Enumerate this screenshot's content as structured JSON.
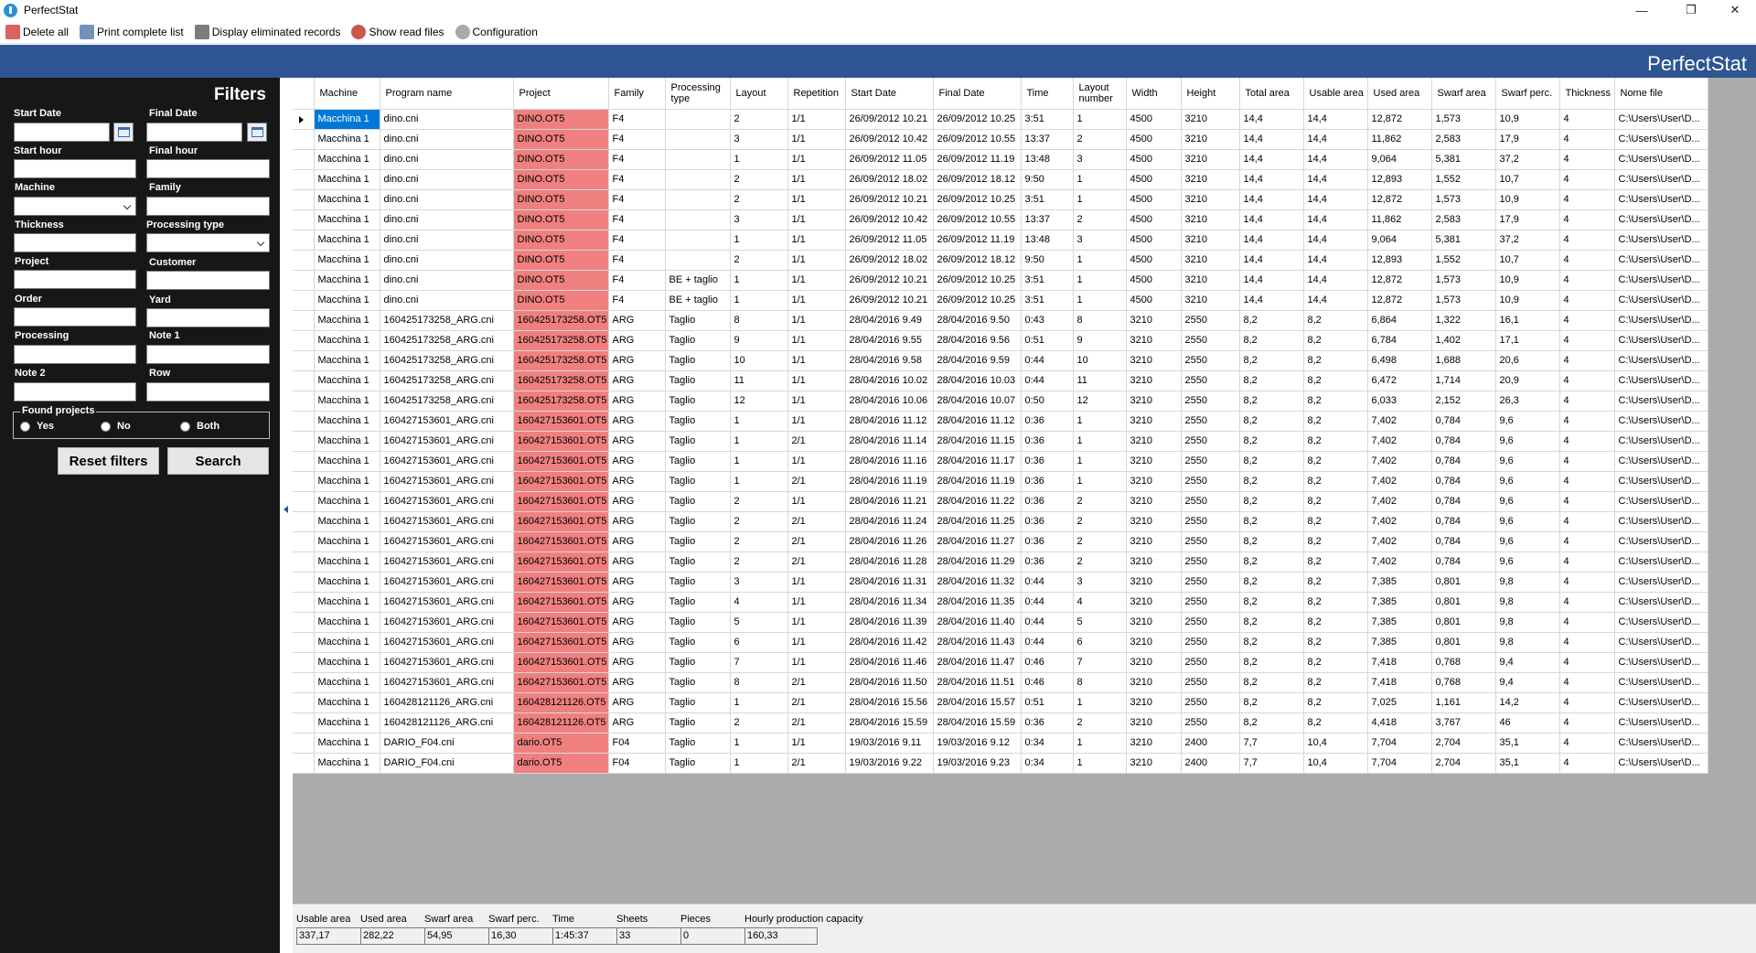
{
  "window": {
    "title": "PerfectStat",
    "minimize": "—",
    "maximize": "❐",
    "close": "✕"
  },
  "toolbar": [
    {
      "label": "Delete all",
      "icon": "eraser-icon",
      "color": "#d64545"
    },
    {
      "label": "Print complete list",
      "icon": "printer-icon",
      "color": "#5b7fae"
    },
    {
      "label": "Display eliminated records",
      "icon": "trash-icon",
      "color": "#666666"
    },
    {
      "label": "Show read files",
      "icon": "file-list-icon",
      "color": "#c0392b"
    },
    {
      "label": "Configuration",
      "icon": "gear-icon",
      "color": "#999999"
    }
  ],
  "banner": {
    "title": "PerfectStat"
  },
  "filters": {
    "title": "Filters",
    "start_date": "Start Date",
    "final_date": "Final Date",
    "start_hour": "Start hour",
    "final_hour": "Final hour",
    "machine": "Machine",
    "family": "Family",
    "thickness": "Thickness",
    "processing_type": "Processing type",
    "project": "Project",
    "customer": "Customer",
    "order": "Order",
    "yard": "Yard",
    "processing": "Processing",
    "note1": "Note 1",
    "note2": "Note 2",
    "row": "Row",
    "found_projects": "Found projects",
    "yes": "Yes",
    "no": "No",
    "both": "Both",
    "reset": "Reset filters",
    "search": "Search"
  },
  "columns": [
    "Machine",
    "Program name",
    "Project",
    "Family",
    "Processing type",
    "Layout",
    "Repetition",
    "Start Date",
    "Final Date",
    "Time",
    "Layout number",
    "Width",
    "Height",
    "Total area",
    "Usable area",
    "Used area",
    "Swarf area",
    "Swarf perc.",
    "Thickness",
    "Nome file"
  ],
  "rows": [
    [
      "Macchina 1",
      "dino.cni",
      "DINO.OT5",
      "F4",
      "",
      "2",
      "1/1",
      "26/09/2012 10.21",
      "26/09/2012 10.25",
      "3:51",
      "1",
      "4500",
      "3210",
      "14,4",
      "14,4",
      "12,872",
      "1,573",
      "10,9",
      "4",
      "C:\\Users\\User\\D..."
    ],
    [
      "Macchina 1",
      "dino.cni",
      "DINO.OT5",
      "F4",
      "",
      "3",
      "1/1",
      "26/09/2012 10.42",
      "26/09/2012 10.55",
      "13:37",
      "2",
      "4500",
      "3210",
      "14,4",
      "14,4",
      "11,862",
      "2,583",
      "17,9",
      "4",
      "C:\\Users\\User\\D..."
    ],
    [
      "Macchina 1",
      "dino.cni",
      "DINO.OT5",
      "F4",
      "",
      "1",
      "1/1",
      "26/09/2012 11.05",
      "26/09/2012 11.19",
      "13:48",
      "3",
      "4500",
      "3210",
      "14,4",
      "14,4",
      "9,064",
      "5,381",
      "37,2",
      "4",
      "C:\\Users\\User\\D..."
    ],
    [
      "Macchina 1",
      "dino.cni",
      "DINO.OT5",
      "F4",
      "",
      "2",
      "1/1",
      "26/09/2012 18.02",
      "26/09/2012 18.12",
      "9:50",
      "1",
      "4500",
      "3210",
      "14,4",
      "14,4",
      "12,893",
      "1,552",
      "10,7",
      "4",
      "C:\\Users\\User\\D..."
    ],
    [
      "Macchina 1",
      "dino.cni",
      "DINO.OT5",
      "F4",
      "",
      "2",
      "1/1",
      "26/09/2012 10.21",
      "26/09/2012 10.25",
      "3:51",
      "1",
      "4500",
      "3210",
      "14,4",
      "14,4",
      "12,872",
      "1,573",
      "10,9",
      "4",
      "C:\\Users\\User\\D..."
    ],
    [
      "Macchina 1",
      "dino.cni",
      "DINO.OT5",
      "F4",
      "",
      "3",
      "1/1",
      "26/09/2012 10.42",
      "26/09/2012 10.55",
      "13:37",
      "2",
      "4500",
      "3210",
      "14,4",
      "14,4",
      "11,862",
      "2,583",
      "17,9",
      "4",
      "C:\\Users\\User\\D..."
    ],
    [
      "Macchina 1",
      "dino.cni",
      "DINO.OT5",
      "F4",
      "",
      "1",
      "1/1",
      "26/09/2012 11.05",
      "26/09/2012 11.19",
      "13:48",
      "3",
      "4500",
      "3210",
      "14,4",
      "14,4",
      "9,064",
      "5,381",
      "37,2",
      "4",
      "C:\\Users\\User\\D..."
    ],
    [
      "Macchina 1",
      "dino.cni",
      "DINO.OT5",
      "F4",
      "",
      "2",
      "1/1",
      "26/09/2012 18.02",
      "26/09/2012 18.12",
      "9:50",
      "1",
      "4500",
      "3210",
      "14,4",
      "14,4",
      "12,893",
      "1,552",
      "10,7",
      "4",
      "C:\\Users\\User\\D..."
    ],
    [
      "Macchina 1",
      "dino.cni",
      "DINO.OT5",
      "F4",
      "BE + taglio",
      "1",
      "1/1",
      "26/09/2012 10.21",
      "26/09/2012 10.25",
      "3:51",
      "1",
      "4500",
      "3210",
      "14,4",
      "14,4",
      "12,872",
      "1,573",
      "10,9",
      "4",
      "C:\\Users\\User\\D..."
    ],
    [
      "Macchina 1",
      "dino.cni",
      "DINO.OT5",
      "F4",
      "BE + taglio",
      "1",
      "1/1",
      "26/09/2012 10.21",
      "26/09/2012 10.25",
      "3:51",
      "1",
      "4500",
      "3210",
      "14,4",
      "14,4",
      "12,872",
      "1,573",
      "10,9",
      "4",
      "C:\\Users\\User\\D..."
    ],
    [
      "Macchina 1",
      "160425173258_ARG.cni",
      "160425173258.OT5",
      "ARG",
      "Taglio",
      "8",
      "1/1",
      "28/04/2016 9.49",
      "28/04/2016 9.50",
      "0:43",
      "8",
      "3210",
      "2550",
      "8,2",
      "8,2",
      "6,864",
      "1,322",
      "16,1",
      "4",
      "C:\\Users\\User\\D..."
    ],
    [
      "Macchina 1",
      "160425173258_ARG.cni",
      "160425173258.OT5",
      "ARG",
      "Taglio",
      "9",
      "1/1",
      "28/04/2016 9.55",
      "28/04/2016 9.56",
      "0:51",
      "9",
      "3210",
      "2550",
      "8,2",
      "8,2",
      "6,784",
      "1,402",
      "17,1",
      "4",
      "C:\\Users\\User\\D..."
    ],
    [
      "Macchina 1",
      "160425173258_ARG.cni",
      "160425173258.OT5",
      "ARG",
      "Taglio",
      "10",
      "1/1",
      "28/04/2016 9.58",
      "28/04/2016 9.59",
      "0:44",
      "10",
      "3210",
      "2550",
      "8,2",
      "8,2",
      "6,498",
      "1,688",
      "20,6",
      "4",
      "C:\\Users\\User\\D..."
    ],
    [
      "Macchina 1",
      "160425173258_ARG.cni",
      "160425173258.OT5",
      "ARG",
      "Taglio",
      "11",
      "1/1",
      "28/04/2016 10.02",
      "28/04/2016 10.03",
      "0:44",
      "11",
      "3210",
      "2550",
      "8,2",
      "8,2",
      "6,472",
      "1,714",
      "20,9",
      "4",
      "C:\\Users\\User\\D..."
    ],
    [
      "Macchina 1",
      "160425173258_ARG.cni",
      "160425173258.OT5",
      "ARG",
      "Taglio",
      "12",
      "1/1",
      "28/04/2016 10.06",
      "28/04/2016 10.07",
      "0:50",
      "12",
      "3210",
      "2550",
      "8,2",
      "8,2",
      "6,033",
      "2,152",
      "26,3",
      "4",
      "C:\\Users\\User\\D..."
    ],
    [
      "Macchina 1",
      "160427153601_ARG.cni",
      "160427153601.OT5",
      "ARG",
      "Taglio",
      "1",
      "1/1",
      "28/04/2016 11.12",
      "28/04/2016 11.12",
      "0:36",
      "1",
      "3210",
      "2550",
      "8,2",
      "8,2",
      "7,402",
      "0,784",
      "9,6",
      "4",
      "C:\\Users\\User\\D..."
    ],
    [
      "Macchina 1",
      "160427153601_ARG.cni",
      "160427153601.OT5",
      "ARG",
      "Taglio",
      "1",
      "2/1",
      "28/04/2016 11.14",
      "28/04/2016 11.15",
      "0:36",
      "1",
      "3210",
      "2550",
      "8,2",
      "8,2",
      "7,402",
      "0,784",
      "9,6",
      "4",
      "C:\\Users\\User\\D..."
    ],
    [
      "Macchina 1",
      "160427153601_ARG.cni",
      "160427153601.OT5",
      "ARG",
      "Taglio",
      "1",
      "1/1",
      "28/04/2016 11.16",
      "28/04/2016 11.17",
      "0:36",
      "1",
      "3210",
      "2550",
      "8,2",
      "8,2",
      "7,402",
      "0,784",
      "9,6",
      "4",
      "C:\\Users\\User\\D..."
    ],
    [
      "Macchina 1",
      "160427153601_ARG.cni",
      "160427153601.OT5",
      "ARG",
      "Taglio",
      "1",
      "2/1",
      "28/04/2016 11.19",
      "28/04/2016 11.19",
      "0:36",
      "1",
      "3210",
      "2550",
      "8,2",
      "8,2",
      "7,402",
      "0,784",
      "9,6",
      "4",
      "C:\\Users\\User\\D..."
    ],
    [
      "Macchina 1",
      "160427153601_ARG.cni",
      "160427153601.OT5",
      "ARG",
      "Taglio",
      "2",
      "1/1",
      "28/04/2016 11.21",
      "28/04/2016 11.22",
      "0:36",
      "2",
      "3210",
      "2550",
      "8,2",
      "8,2",
      "7,402",
      "0,784",
      "9,6",
      "4",
      "C:\\Users\\User\\D..."
    ],
    [
      "Macchina 1",
      "160427153601_ARG.cni",
      "160427153601.OT5",
      "ARG",
      "Taglio",
      "2",
      "2/1",
      "28/04/2016 11.24",
      "28/04/2016 11.25",
      "0:36",
      "2",
      "3210",
      "2550",
      "8,2",
      "8,2",
      "7,402",
      "0,784",
      "9,6",
      "4",
      "C:\\Users\\User\\D..."
    ],
    [
      "Macchina 1",
      "160427153601_ARG.cni",
      "160427153601.OT5",
      "ARG",
      "Taglio",
      "2",
      "2/1",
      "28/04/2016 11.26",
      "28/04/2016 11.27",
      "0:36",
      "2",
      "3210",
      "2550",
      "8,2",
      "8,2",
      "7,402",
      "0,784",
      "9,6",
      "4",
      "C:\\Users\\User\\D..."
    ],
    [
      "Macchina 1",
      "160427153601_ARG.cni",
      "160427153601.OT5",
      "ARG",
      "Taglio",
      "2",
      "2/1",
      "28/04/2016 11.28",
      "28/04/2016 11.29",
      "0:36",
      "2",
      "3210",
      "2550",
      "8,2",
      "8,2",
      "7,402",
      "0,784",
      "9,6",
      "4",
      "C:\\Users\\User\\D..."
    ],
    [
      "Macchina 1",
      "160427153601_ARG.cni",
      "160427153601.OT5",
      "ARG",
      "Taglio",
      "3",
      "1/1",
      "28/04/2016 11.31",
      "28/04/2016 11.32",
      "0:44",
      "3",
      "3210",
      "2550",
      "8,2",
      "8,2",
      "7,385",
      "0,801",
      "9,8",
      "4",
      "C:\\Users\\User\\D..."
    ],
    [
      "Macchina 1",
      "160427153601_ARG.cni",
      "160427153601.OT5",
      "ARG",
      "Taglio",
      "4",
      "1/1",
      "28/04/2016 11.34",
      "28/04/2016 11.35",
      "0:44",
      "4",
      "3210",
      "2550",
      "8,2",
      "8,2",
      "7,385",
      "0,801",
      "9,8",
      "4",
      "C:\\Users\\User\\D..."
    ],
    [
      "Macchina 1",
      "160427153601_ARG.cni",
      "160427153601.OT5",
      "ARG",
      "Taglio",
      "5",
      "1/1",
      "28/04/2016 11.39",
      "28/04/2016 11.40",
      "0:44",
      "5",
      "3210",
      "2550",
      "8,2",
      "8,2",
      "7,385",
      "0,801",
      "9,8",
      "4",
      "C:\\Users\\User\\D..."
    ],
    [
      "Macchina 1",
      "160427153601_ARG.cni",
      "160427153601.OT5",
      "ARG",
      "Taglio",
      "6",
      "1/1",
      "28/04/2016 11.42",
      "28/04/2016 11.43",
      "0:44",
      "6",
      "3210",
      "2550",
      "8,2",
      "8,2",
      "7,385",
      "0,801",
      "9,8",
      "4",
      "C:\\Users\\User\\D..."
    ],
    [
      "Macchina 1",
      "160427153601_ARG.cni",
      "160427153601.OT5",
      "ARG",
      "Taglio",
      "7",
      "1/1",
      "28/04/2016 11.46",
      "28/04/2016 11.47",
      "0:46",
      "7",
      "3210",
      "2550",
      "8,2",
      "8,2",
      "7,418",
      "0,768",
      "9,4",
      "4",
      "C:\\Users\\User\\D..."
    ],
    [
      "Macchina 1",
      "160427153601_ARG.cni",
      "160427153601.OT5",
      "ARG",
      "Taglio",
      "8",
      "2/1",
      "28/04/2016 11.50",
      "28/04/2016 11.51",
      "0:46",
      "8",
      "3210",
      "2550",
      "8,2",
      "8,2",
      "7,418",
      "0,768",
      "9,4",
      "4",
      "C:\\Users\\User\\D..."
    ],
    [
      "Macchina 1",
      "160428121126_ARG.cni",
      "160428121126.OT5",
      "ARG",
      "Taglio",
      "1",
      "2/1",
      "28/04/2016 15.56",
      "28/04/2016 15.57",
      "0:51",
      "1",
      "3210",
      "2550",
      "8,2",
      "8,2",
      "7,025",
      "1,161",
      "14,2",
      "4",
      "C:\\Users\\User\\D..."
    ],
    [
      "Macchina 1",
      "160428121126_ARG.cni",
      "160428121126.OT5",
      "ARG",
      "Taglio",
      "2",
      "2/1",
      "28/04/2016 15.59",
      "28/04/2016 15.59",
      "0:36",
      "2",
      "3210",
      "2550",
      "8,2",
      "8,2",
      "4,418",
      "3,767",
      "46",
      "4",
      "C:\\Users\\User\\D..."
    ],
    [
      "Macchina 1",
      "DARIO_F04.cni",
      "dario.OT5",
      "F04",
      "Taglio",
      "1",
      "1/1",
      "19/03/2016 9.11",
      "19/03/2016 9.12",
      "0:34",
      "1",
      "3210",
      "2400",
      "7,7",
      "10,4",
      "7,704",
      "2,704",
      "35,1",
      "4",
      "C:\\Users\\User\\D..."
    ],
    [
      "Macchina 1",
      "DARIO_F04.cni",
      "dario.OT5",
      "F04",
      "Taglio",
      "1",
      "2/1",
      "19/03/2016 9.22",
      "19/03/2016 9.23",
      "0:34",
      "1",
      "3210",
      "2400",
      "7,7",
      "10,4",
      "7,704",
      "2,704",
      "35,1",
      "4",
      "C:\\Users\\User\\D..."
    ]
  ],
  "summary": [
    {
      "label": "Usable area",
      "value": "337,17"
    },
    {
      "label": "Used area",
      "value": "282,22"
    },
    {
      "label": "Swarf area",
      "value": "54,95"
    },
    {
      "label": "Swarf perc.",
      "value": "16,30"
    },
    {
      "label": "Time",
      "value": "1:45:37"
    },
    {
      "label": "Sheets",
      "value": "33"
    },
    {
      "label": "Pieces",
      "value": "0"
    },
    {
      "label": "Hourly production capacity",
      "value": "160,33"
    }
  ],
  "colors": {
    "banner": "#2e5591",
    "project_cell": "#f08080",
    "selection": "#0078d7",
    "sidebar": "#171717"
  }
}
